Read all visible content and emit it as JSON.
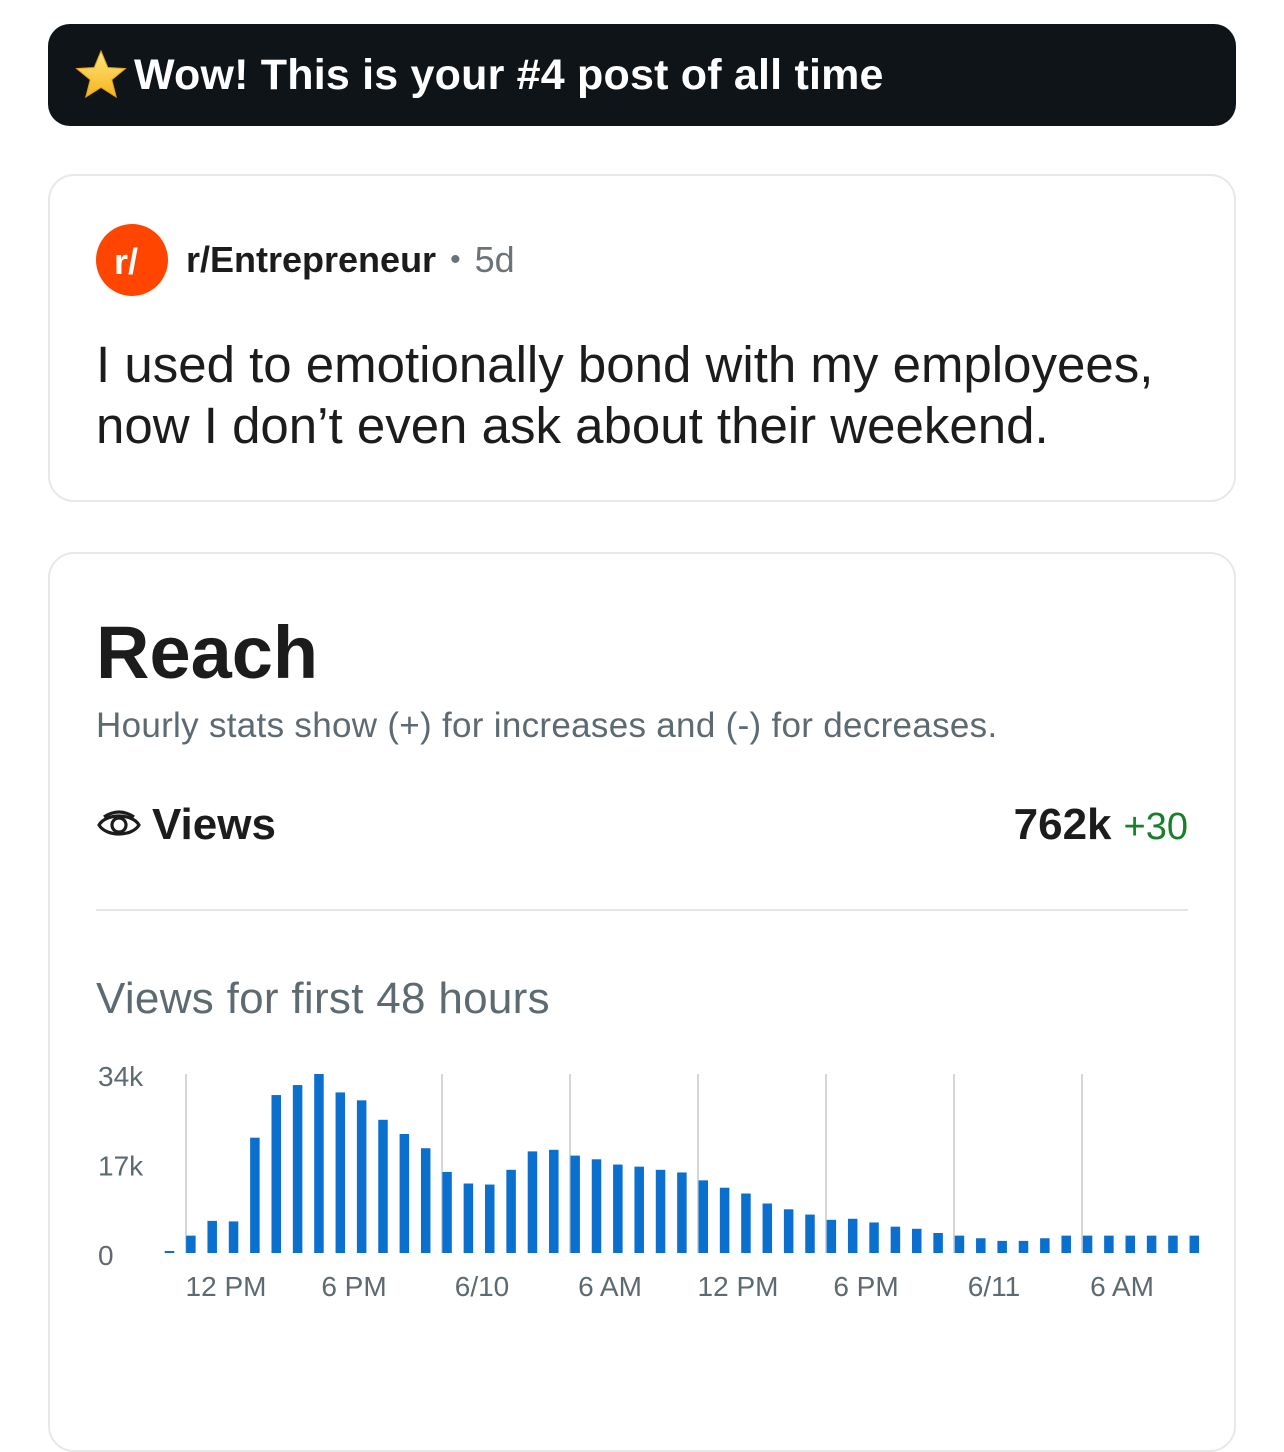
{
  "banner": {
    "text": "Wow! This is your #4 post of all time",
    "icon": "star-icon"
  },
  "post": {
    "subreddit": "r/Entrepreneur",
    "separator": "•",
    "age": "5d",
    "title": "I used to emotionally bond with my employees, now I don’t even ask about their weekend.",
    "subreddit_icon": "reddit-r-icon"
  },
  "reach": {
    "title": "Reach",
    "subtitle": "Hourly stats show (+) for increases and (-) for decreases.",
    "views_label": "Views",
    "views_value": "762k",
    "views_delta": "+30",
    "chart_title": "Views for first 48 hours"
  },
  "colors": {
    "bar": "#0a6fcd",
    "delta": "#1a7f2a",
    "subreddit": "#ff4500"
  },
  "chart_data": {
    "type": "bar",
    "y_ticks": [
      "0",
      "17k",
      "34k"
    ],
    "x_ticks": [
      "12 PM",
      "6 PM",
      "6/10",
      "6 AM",
      "12 PM",
      "6 PM",
      "6/11",
      "6 AM"
    ],
    "ylim": [
      0,
      34000
    ],
    "grid": true,
    "values": [
      300,
      3300,
      6100,
      6000,
      21900,
      30000,
      31900,
      34000,
      30500,
      29000,
      25300,
      22600,
      19900,
      15400,
      13200,
      13000,
      15800,
      19300,
      19600,
      18500,
      17800,
      16800,
      16400,
      15800,
      15300,
      13800,
      12400,
      11300,
      9400,
      8300,
      7300,
      6300,
      6500,
      5800,
      5000,
      4600,
      3800,
      3300,
      2800,
      2300,
      2300,
      2800,
      3300,
      3300,
      3300,
      3300,
      3300,
      3300,
      3300
    ]
  }
}
